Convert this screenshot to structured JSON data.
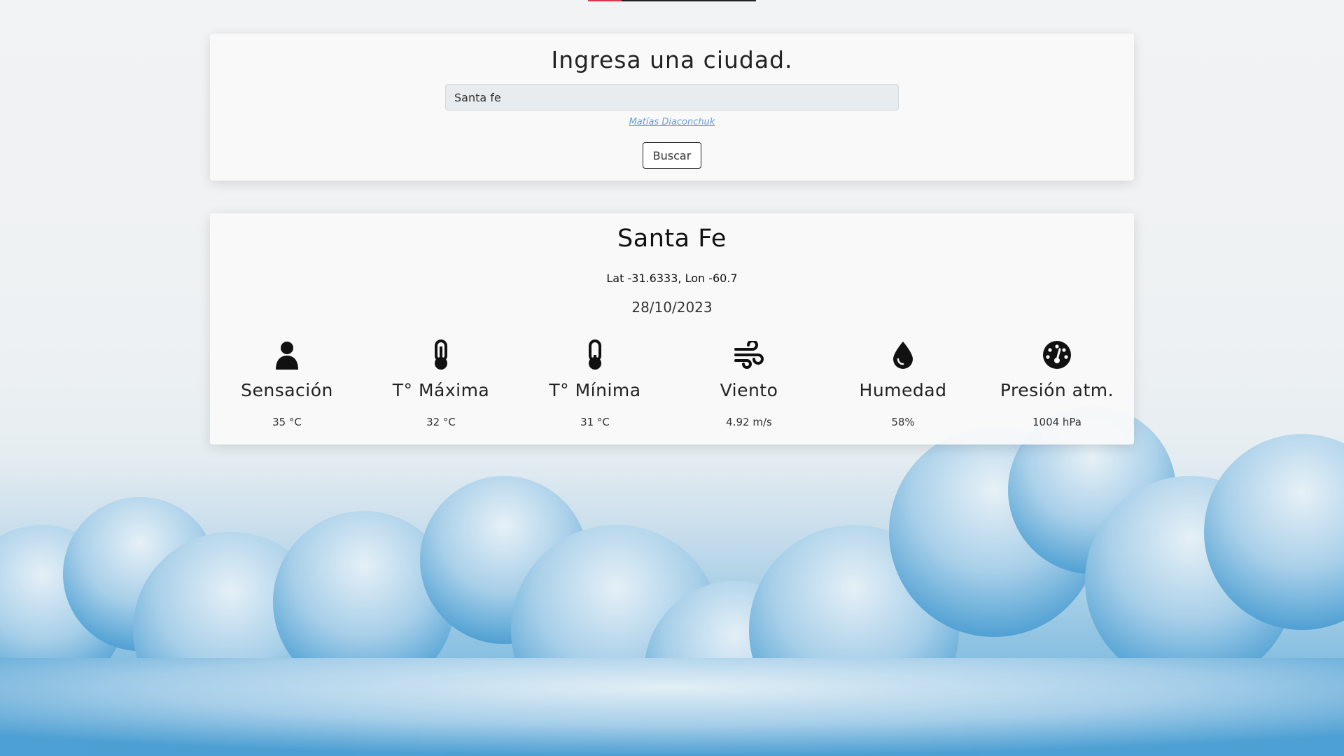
{
  "search": {
    "title": "Ingresa una ciudad.",
    "input_value": "Santa fe",
    "author_link": "Matías Diaconchuk",
    "button_label": "Buscar"
  },
  "weather": {
    "city": "Santa Fe",
    "coords": "Lat -31.6333, Lon -60.7",
    "date": "28/10/2023",
    "stats": [
      {
        "icon": "person-icon",
        "label": "Sensación",
        "value": "35 °C"
      },
      {
        "icon": "thermometer-high-icon",
        "label": "T° Máxima",
        "value": "32 °C"
      },
      {
        "icon": "thermometer-low-icon",
        "label": "T° Mínima",
        "value": "31 °C"
      },
      {
        "icon": "wind-icon",
        "label": "Viento",
        "value": "4.92 m/s"
      },
      {
        "icon": "droplet-icon",
        "label": "Humedad",
        "value": "58%"
      },
      {
        "icon": "gauge-icon",
        "label": "Presión atm.",
        "value": "1004 hPa"
      }
    ]
  },
  "colors": {
    "accent": "#e0384b",
    "link": "#6d9bd1",
    "sky": "#5aa7d6"
  }
}
